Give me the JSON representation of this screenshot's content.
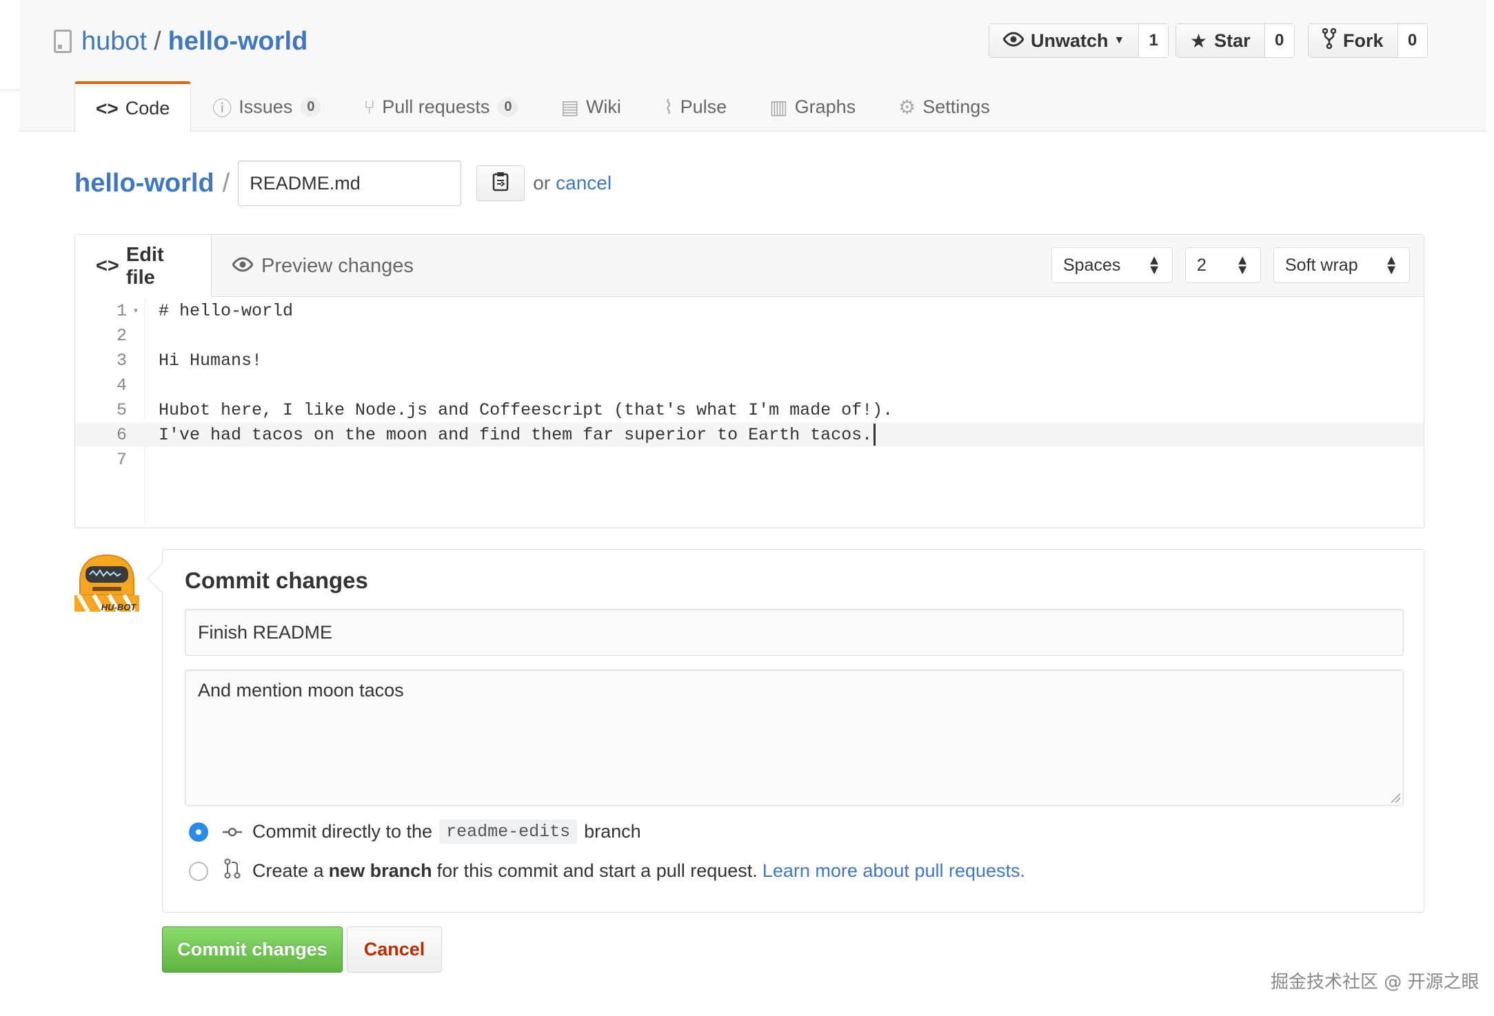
{
  "repo": {
    "owner": "hubot",
    "separator": "/",
    "name": "hello-world"
  },
  "actions": {
    "watch": {
      "label": "Unwatch",
      "count": "1"
    },
    "star": {
      "label": "Star",
      "count": "0"
    },
    "fork": {
      "label": "Fork",
      "count": "0"
    }
  },
  "nav": {
    "code": "Code",
    "issues": {
      "label": "Issues",
      "count": "0"
    },
    "pulls": {
      "label": "Pull requests",
      "count": "0"
    },
    "wiki": "Wiki",
    "pulse": "Pulse",
    "graphs": "Graphs",
    "settings": "Settings"
  },
  "breadcrumb": {
    "repo": "hello-world",
    "separator": "/",
    "filename": "README.md",
    "or": "or",
    "cancel": "cancel"
  },
  "editor": {
    "edit_tab": "Edit file",
    "preview_tab": "Preview changes",
    "indent_mode": "Spaces",
    "indent_size": "2",
    "wrap_mode": "Soft wrap",
    "lines": [
      {
        "num": "1",
        "text": "# hello-world"
      },
      {
        "num": "2",
        "text": ""
      },
      {
        "num": "3",
        "text": "Hi Humans!"
      },
      {
        "num": "4",
        "text": ""
      },
      {
        "num": "5",
        "text": "Hubot here, I like Node.js and Coffeescript (that's what I'm made of!)."
      },
      {
        "num": "6",
        "text": "I've had tacos on the moon and find them far superior to Earth tacos."
      },
      {
        "num": "7",
        "text": ""
      }
    ],
    "active_line": 6
  },
  "commit": {
    "heading": "Commit changes",
    "summary": "Finish README",
    "description": "And mention moon tacos",
    "option_direct": {
      "before": "Commit directly to the",
      "branch": "readme-edits",
      "after": "branch"
    },
    "option_new": {
      "before": "Create a",
      "bold": "new branch",
      "after": "for this commit and start a pull request.",
      "link": "Learn more about pull requests."
    },
    "submit": "Commit changes",
    "cancel": "Cancel",
    "avatar_label": "HU-BOT"
  },
  "watermark": "掘金技术社区 @ 开源之眼",
  "colors": {
    "link": "#4078c0",
    "accent_tab": "#d26911",
    "commit_green": "#60b044",
    "cancel_red": "#bd2c00",
    "radio_blue": "#2a8be6"
  }
}
